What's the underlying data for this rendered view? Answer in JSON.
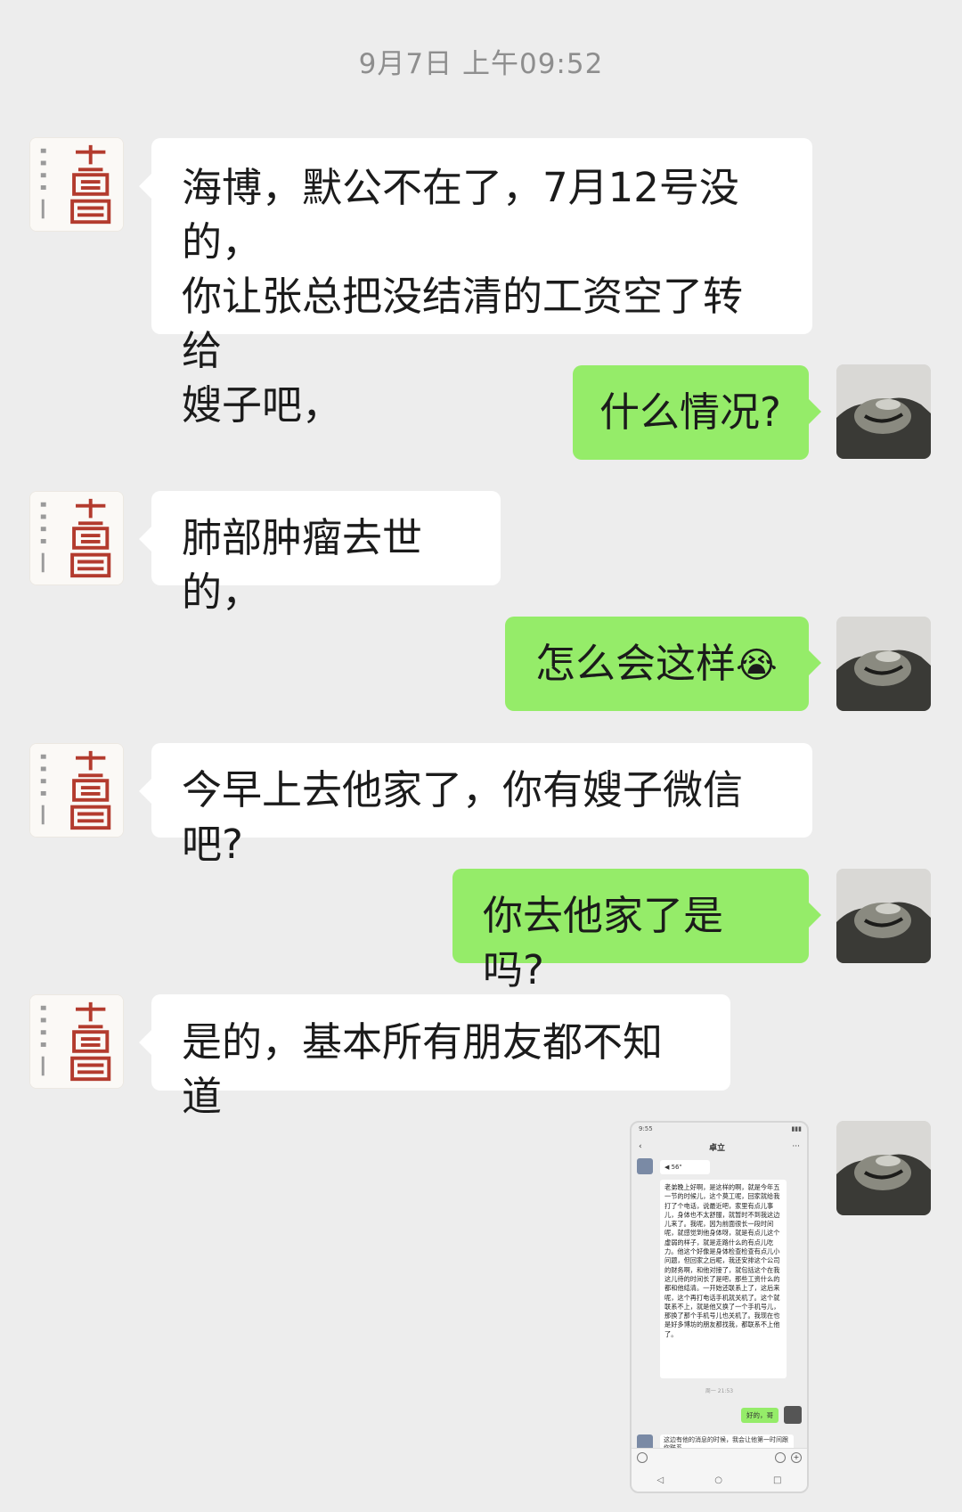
{
  "timestamp": "9月7日 上午09:52",
  "messages": [
    {
      "side": "in",
      "lines": [
        "海博，默公不在了，7月12号没的，",
        "你让张总把没结清的工资空了转给",
        "嫂子吧，"
      ]
    },
    {
      "side": "out",
      "text": "什么情况?"
    },
    {
      "side": "in",
      "text": "肺部肿瘤去世的，"
    },
    {
      "side": "out",
      "text": "怎么会这样",
      "emoji": "😭"
    },
    {
      "side": "in",
      "text": "今早上去他家了，你有嫂子微信吧?"
    },
    {
      "side": "out",
      "text": "你去他家了是吗?"
    },
    {
      "side": "in",
      "text": "是的，基本所有朋友都不知道"
    }
  ],
  "seal": {
    "small_text": "活在当下",
    "mark": "大閑",
    "color": "#b33b2e"
  },
  "shared_screenshot": {
    "status_time": "9:55",
    "contact_name": "卓立",
    "voice_label": "◀ 56\"",
    "long_message": "老弟晚上好啊，是这样的啊，就是今年五一节的时候儿，这个莫工呢，回家就给我打了个电话，说最近吧，家里有点儿事儿，身体也不太舒服，就暂时不到我这边儿来了。我呢，因为前面很长一段时间呢，就感觉到他身体呀，就是有点儿这个虚弱的样子，就是走路什么的有点儿吃力。他这个好像是身体检查检查有点儿小问题，但回家之后呢，我还安排这个公司的财务啊，和他对接了，就包括这个在我这儿待的时间长了是吧，那些工资什么的都和他结清。一开始还联系上了，这后来呢，这个再打电话手机就关机了。这个就联系不上，就是他又换了一个手机号儿，那换了那个手机号儿也关机了。我现在也是好多博坊的朋友都找我，都联系不上他了。",
    "time_label": "周一 21:53",
    "reply": "好的，哥",
    "last_message": "这边有他的消息的时候，我会让他第一时间跟你联系"
  }
}
